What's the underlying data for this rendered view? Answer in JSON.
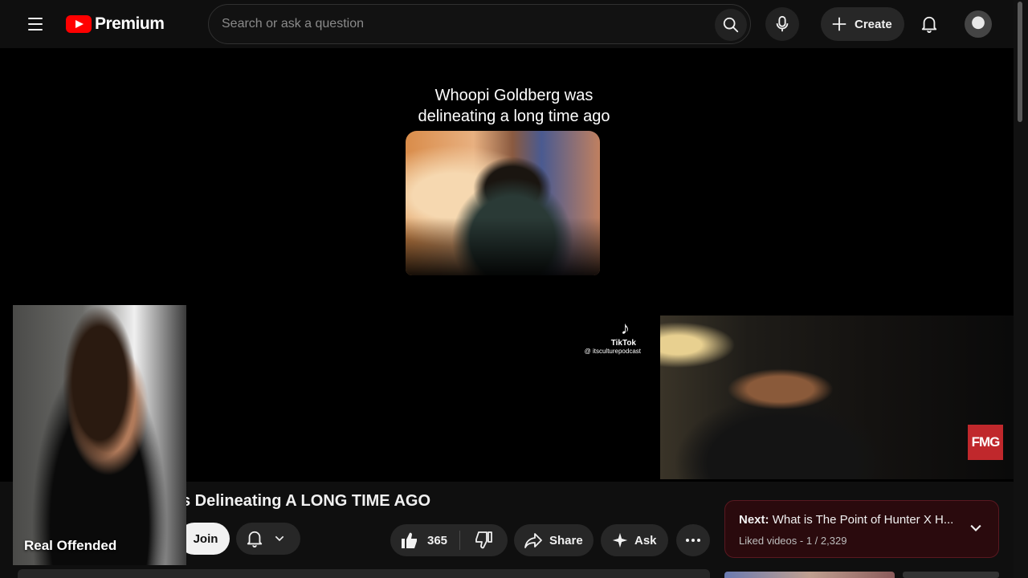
{
  "header": {
    "logo_text": "Premium",
    "search": {
      "placeholder": "Search or ask a question",
      "value": ""
    },
    "create_label": "Create"
  },
  "video": {
    "overlay_title_line1": "Whoopi Goldberg was",
    "overlay_title_line2": "delineating a long time ago",
    "tiktok_brand": "TikTok",
    "tiktok_handle": "@ itsculturepodcast",
    "left_cam_label": "Real Offended",
    "badge_text": "FMG"
  },
  "info": {
    "title": "s Delineating A LONG TIME AGO",
    "join_label": "Join",
    "like_count": "365",
    "share_label": "Share",
    "ask_label": "Ask"
  },
  "next": {
    "prefix": "Next:",
    "title": "What is The Point of Hunter X H...",
    "subtitle": "Liked videos - 1 / 2,329"
  },
  "colors": {
    "brand_red": "#ff0000",
    "background": "#0f0f0f",
    "next_box_bg": "#2a0a0d"
  },
  "icons": [
    "menu-icon",
    "youtube-logo-icon",
    "search-icon",
    "mic-icon",
    "plus-icon",
    "bell-icon",
    "chevron-down-icon",
    "thumb-up-icon",
    "thumb-down-icon",
    "share-icon",
    "sparkle-icon",
    "more-icon",
    "tiktok-icon"
  ]
}
